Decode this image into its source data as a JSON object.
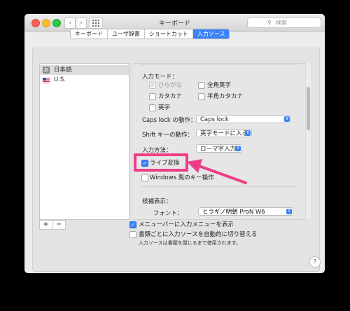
{
  "window": {
    "title": "キーボード",
    "search_placeholder": "検索",
    "nav_back": "‹",
    "nav_forward": "›",
    "grid_icon": "grid-icon"
  },
  "tabs": [
    {
      "label": "キーボード",
      "active": false
    },
    {
      "label": "ユーザ辞書",
      "active": false
    },
    {
      "label": "ショートカット",
      "active": false
    },
    {
      "label": "入力ソース",
      "active": true
    }
  ],
  "sources": [
    {
      "label": "日本語",
      "icon": "あ",
      "selected": true
    },
    {
      "label": "U.S.",
      "icon": "us-flag-icon",
      "selected": false
    }
  ],
  "source_buttons": {
    "add": "+",
    "remove": "−"
  },
  "settings": {
    "input_mode_label": "入力モード：",
    "modes": [
      {
        "label": "ひらがな",
        "checked": true,
        "disabled": true
      },
      {
        "label": "全角英字",
        "checked": false,
        "disabled": false
      },
      {
        "label": "カタカナ",
        "checked": false,
        "disabled": false
      },
      {
        "label": "半角カタカナ",
        "checked": false,
        "disabled": false
      },
      {
        "label": "英字",
        "checked": false,
        "disabled": false
      }
    ],
    "capslock_label": "Caps lock の動作：",
    "capslock_value": "Caps lock",
    "shift_label": "Shift キーの動作：",
    "shift_value": "英字モードに入る",
    "method_label": "入力方法：",
    "method_value": "ローマ字入力",
    "live_conversion_label": "ライブ変換",
    "live_conversion_checked": true,
    "windows_label": "Windows 風のキー操作",
    "windows_checked": false,
    "candidates_label": "候補表示：",
    "font_label": "フォント：",
    "font_value": "ヒラギノ明朝 ProN W6"
  },
  "bottom": {
    "show_menu_label": "メニューバーに入力メニューを表示",
    "show_menu_checked": true,
    "auto_switch_label": "書類ごとに入力ソースを自動的に切り替える",
    "auto_switch_checked": false,
    "auto_switch_note": "入力ソースは書類を閉じるまで使用されます。"
  },
  "help_label": "?",
  "colors": {
    "accent": "#3a82f7",
    "highlight": "#ee3d86"
  }
}
